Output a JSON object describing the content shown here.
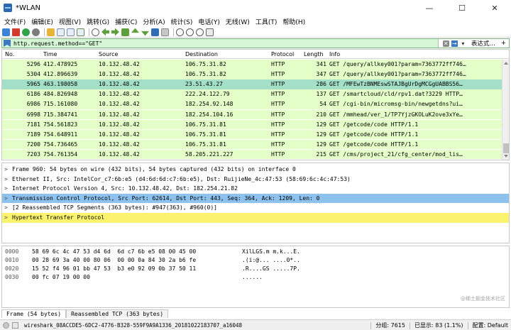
{
  "window": {
    "title": "*WLAN",
    "minimize": "—",
    "maximize": "☐",
    "close": "✕"
  },
  "menu": [
    "文件(F)",
    "编辑(E)",
    "视图(V)",
    "跳转(G)",
    "捕获(C)",
    "分析(A)",
    "统计(S)",
    "电话(Y)",
    "无线(W)",
    "工具(T)",
    "帮助(H)"
  ],
  "filter": {
    "value": "http.request.method==\"GET\"",
    "expression_label": "表达式…",
    "plus_label": "+"
  },
  "packet_list": {
    "columns": [
      "No.",
      "Time",
      "Source",
      "Destination",
      "Protocol",
      "Length",
      "Info"
    ],
    "rows": [
      {
        "no": "5296",
        "time": "412.478925",
        "src": "10.132.48.42",
        "dst": "106.75.31.82",
        "proto": "HTTP",
        "len": "341",
        "info": "GET /query/allkey001?param=7363772ff746…"
      },
      {
        "no": "5304",
        "time": "412.896639",
        "src": "10.132.48.42",
        "dst": "106.75.31.82",
        "proto": "HTTP",
        "len": "347",
        "info": "GET /query/allkey001?param=7363772ff746…"
      },
      {
        "no": "5965",
        "time": "463.198058",
        "src": "10.132.48.42",
        "dst": "23.51.43.27",
        "proto": "HTTP",
        "len": "286",
        "info": "GET /MFEwTzBNMEswSTAJBgUrDgMCGgUABBS56…"
      },
      {
        "no": "6186",
        "time": "484.826948",
        "src": "10.132.48.42",
        "dst": "222.24.122.79",
        "proto": "HTTP",
        "len": "137",
        "info": "GET /smartcloud/cld/rpv1.dat?3229 HTTP…"
      },
      {
        "no": "6986",
        "time": "715.161080",
        "src": "10.132.48.42",
        "dst": "182.254.92.148",
        "proto": "HTTP",
        "len": "54",
        "info": "GET /cgi-bin/micromsg-bin/newgetdns?ui…"
      },
      {
        "no": "6998",
        "time": "715.384741",
        "src": "10.132.48.42",
        "dst": "182.254.104.16",
        "proto": "HTTP",
        "len": "210",
        "info": "GET /mmhead/ver_1/TP7YjzGKOLuK2ove3xYe…"
      },
      {
        "no": "7181",
        "time": "754.561823",
        "src": "10.132.48.42",
        "dst": "106.75.31.81",
        "proto": "HTTP",
        "len": "129",
        "info": "GET /getcode/code HTTP/1.1"
      },
      {
        "no": "7189",
        "time": "754.648911",
        "src": "10.132.48.42",
        "dst": "106.75.31.81",
        "proto": "HTTP",
        "len": "129",
        "info": "GET /getcode/code HTTP/1.1"
      },
      {
        "no": "7200",
        "time": "754.736465",
        "src": "10.132.48.42",
        "dst": "106.75.31.81",
        "proto": "HTTP",
        "len": "129",
        "info": "GET /getcode/code HTTP/1.1"
      },
      {
        "no": "7203",
        "time": "754.761354",
        "src": "10.132.48.42",
        "dst": "58.205.221.227",
        "proto": "HTTP",
        "len": "215",
        "info": "GET /cms/project_21/cfg_center/mod_lis…"
      }
    ],
    "selected_index": 2
  },
  "details": [
    {
      "expander": ">",
      "text": "Frame 960: 54 bytes on wire (432 bits), 54 bytes captured (432 bits) on interface 0",
      "style": ""
    },
    {
      "expander": ">",
      "text": "Ethernet II, Src: IntelCor_c7:6b:e5 (d4:6d:6d:c7:6b:e5), Dst: RuijieNe_4c:47:53 (58:69:6c:4c:47:53)",
      "style": ""
    },
    {
      "expander": ">",
      "text": "Internet Protocol Version 4, Src: 10.132.48.42, Dst: 182.254.21.82",
      "style": ""
    },
    {
      "expander": ">",
      "text": "Transmission Control Protocol, Src Port: 62614, Dst Port: 443, Seq: 364, Ack: 1209, Len: 0",
      "style": "sel"
    },
    {
      "expander": ">",
      "text": "[2 Reassembled TCP Segments (363 bytes): #947(363), #960(0)]",
      "style": ""
    },
    {
      "expander": ">",
      "text": "Hypertext Transfer Protocol",
      "style": "http"
    }
  ],
  "bytes": [
    {
      "offset": "0000",
      "hex": "58 69 6c 4c 47 53 d4 6d  6d c7 6b e5 08 00 45 00",
      "ascii": "XilLGS.m m.k...E."
    },
    {
      "offset": "0010",
      "hex": "00 28 69 3a 40 00 80 06  00 00 0a 84 30 2a b6 fe",
      "ascii": ".(i:@... ....0*.."
    },
    {
      "offset": "0020",
      "hex": "15 52 f4 96 01 bb 47 53  b3 e0 92 09 0b 37 50 11",
      "ascii": ".R....GS .....7P."
    },
    {
      "offset": "0030",
      "hex": "00 fc 07 19 00 00",
      "ascii": "......"
    }
  ],
  "byte_tabs": [
    "Frame (54 bytes)",
    "Reassembled TCP (363 bytes)"
  ],
  "status": {
    "file": "wireshark_08ACCDE5-6DC2-4776-B328-559F9A9A1336_20181022183707_a16048",
    "packets": "分组: 7615",
    "displayed": "已显示: 83 (1.1%)",
    "profile": "配置: Default"
  },
  "watermark": "@稀土掘金技术社区",
  "colors": {
    "row_bg": "#e4ffc7",
    "row_selected": "#a4e0c8",
    "filter_bg": "#d4f6d4",
    "detail_selected": "#8ec2ee",
    "detail_http": "#fbf36e"
  }
}
